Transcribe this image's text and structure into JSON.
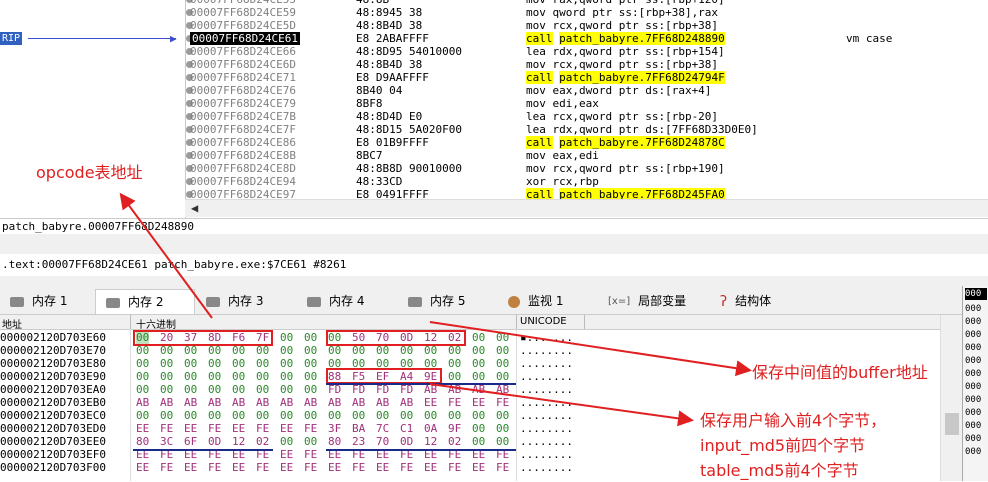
{
  "disasm": {
    "rip_label": "RIP",
    "rows": [
      {
        "addr": "00007FF68D24CE55",
        "bytes": "48:8B",
        "ins": "mov rax,qword ptr ss:[rbp+120]",
        "cmt": ""
      },
      {
        "addr": "00007FF68D24CE59",
        "bytes": "48:8945 38",
        "ins": "mov qword ptr ss:[rbp+38],rax",
        "cmt": ""
      },
      {
        "addr": "00007FF68D24CE5D",
        "bytes": "48:8B4D 38",
        "ins": "mov rcx,qword ptr ss:[rbp+38]",
        "cmt": ""
      },
      {
        "addr": "00007FF68D24CE61",
        "bytes": "E8 2ABAFFFF",
        "ins_kw": "call",
        "ins_arg": "patch_babyre.7FF68D248890",
        "cmt": "vm case",
        "current": true
      },
      {
        "addr": "00007FF68D24CE66",
        "bytes": "48:8D95 54010000",
        "ins": "lea rdx,qword ptr ss:[rbp+154]",
        "cmt": ""
      },
      {
        "addr": "00007FF68D24CE6D",
        "bytes": "48:8B4D 38",
        "ins": "mov rcx,qword ptr ss:[rbp+38]",
        "cmt": ""
      },
      {
        "addr": "00007FF68D24CE71",
        "bytes": "E8 D9AAFFFF",
        "ins_kw": "call",
        "ins_arg": "patch_babyre.7FF68D24794F",
        "cmt": ""
      },
      {
        "addr": "00007FF68D24CE76",
        "bytes": "8B40 04",
        "ins": "mov eax,dword ptr ds:[rax+4]",
        "cmt": ""
      },
      {
        "addr": "00007FF68D24CE79",
        "bytes": "8BF8",
        "ins": "mov edi,eax",
        "cmt": ""
      },
      {
        "addr": "00007FF68D24CE7B",
        "bytes": "48:8D4D E0",
        "ins": "lea rcx,qword ptr ss:[rbp-20]",
        "cmt": ""
      },
      {
        "addr": "00007FF68D24CE7F",
        "bytes": "48:8D15 5A020F00",
        "ins": "lea rdx,qword ptr ds:[7FF68D33D0E0]",
        "cmt": ""
      },
      {
        "addr": "00007FF68D24CE86",
        "bytes": "E8 01B9FFFF",
        "ins_kw": "call",
        "ins_arg": "patch_babyre.7FF68D24878C",
        "cmt": ""
      },
      {
        "addr": "00007FF68D24CE8B",
        "bytes": "8BC7",
        "ins": "mov eax,edi",
        "cmt": ""
      },
      {
        "addr": "00007FF68D24CE8D",
        "bytes": "48:8B8D 90010000",
        "ins": "mov rcx,qword ptr ss:[rbp+190]",
        "cmt": ""
      },
      {
        "addr": "00007FF68D24CE94",
        "bytes": "48:33CD",
        "ins": "xor rcx,rbp",
        "cmt": ""
      },
      {
        "addr": "00007FF68D24CE97",
        "bytes": "E8 0491FFFF",
        "ins_kw": "call",
        "ins_arg": "patch_babyre.7FF68D245FA0",
        "cmt": ""
      }
    ]
  },
  "info_line1": "patch_babyre.00007FF68D248890",
  "info_line2": ".text:00007FF68D24CE61 patch_babyre.exe:$7CE61 #8261",
  "tabs": [
    {
      "label": "内存 1",
      "icon": "memory-icon"
    },
    {
      "label": "内存 2",
      "icon": "memory-icon",
      "active": true
    },
    {
      "label": "内存 3",
      "icon": "memory-icon"
    },
    {
      "label": "内存 4",
      "icon": "memory-icon"
    },
    {
      "label": "内存 5",
      "icon": "memory-icon"
    },
    {
      "label": "监视 1",
      "icon": "watch-icon"
    },
    {
      "label": "局部变量",
      "icon": "locals-icon",
      "prefix": "[x=]"
    },
    {
      "label": "结构体",
      "icon": "struct-icon"
    }
  ],
  "hex": {
    "col_addr": "地址",
    "col_hex": "十六进制",
    "col_ascii": "UNICODE",
    "rows": [
      {
        "addr": "000002120D703E60",
        "bytes": [
          "00",
          "20",
          "37",
          "8D",
          "F6",
          "7F",
          "00",
          "00",
          "00",
          "50",
          "70",
          "0D",
          "12",
          "02",
          "00",
          "00"
        ],
        "ascii": "▪......."
      },
      {
        "addr": "000002120D703E70",
        "bytes": [
          "00",
          "00",
          "00",
          "00",
          "00",
          "00",
          "00",
          "00",
          "00",
          "00",
          "00",
          "00",
          "00",
          "00",
          "00",
          "00"
        ],
        "ascii": "........"
      },
      {
        "addr": "000002120D703E80",
        "bytes": [
          "00",
          "00",
          "00",
          "00",
          "00",
          "00",
          "00",
          "00",
          "00",
          "00",
          "00",
          "00",
          "00",
          "00",
          "00",
          "00"
        ],
        "ascii": "........"
      },
      {
        "addr": "000002120D703E90",
        "bytes": [
          "00",
          "00",
          "00",
          "00",
          "00",
          "00",
          "00",
          "00",
          "88",
          "F5",
          "EF",
          "A4",
          "9E",
          "00",
          "00",
          "00"
        ],
        "ascii": "........"
      },
      {
        "addr": "000002120D703EA0",
        "bytes": [
          "00",
          "00",
          "00",
          "00",
          "00",
          "00",
          "00",
          "00",
          "FD",
          "FD",
          "FD",
          "FD",
          "AB",
          "AB",
          "AB",
          "AB"
        ],
        "ascii": "........"
      },
      {
        "addr": "000002120D703EB0",
        "bytes": [
          "AB",
          "AB",
          "AB",
          "AB",
          "AB",
          "AB",
          "AB",
          "AB",
          "AB",
          "AB",
          "AB",
          "AB",
          "EE",
          "FE",
          "EE",
          "FE"
        ],
        "ascii": "........"
      },
      {
        "addr": "000002120D703EC0",
        "bytes": [
          "00",
          "00",
          "00",
          "00",
          "00",
          "00",
          "00",
          "00",
          "00",
          "00",
          "00",
          "00",
          "00",
          "00",
          "00",
          "00"
        ],
        "ascii": "........"
      },
      {
        "addr": "000002120D703ED0",
        "bytes": [
          "EE",
          "FE",
          "EE",
          "FE",
          "EE",
          "FE",
          "EE",
          "FE",
          "3F",
          "BA",
          "7C",
          "C1",
          "0A",
          "9F",
          "00",
          "00"
        ],
        "ascii": "........"
      },
      {
        "addr": "000002120D703EE0",
        "bytes": [
          "80",
          "3C",
          "6F",
          "0D",
          "12",
          "02",
          "00",
          "00",
          "80",
          "23",
          "70",
          "0D",
          "12",
          "02",
          "00",
          "00"
        ],
        "ascii": "........"
      },
      {
        "addr": "000002120D703EF0",
        "bytes": [
          "EE",
          "FE",
          "EE",
          "FE",
          "EE",
          "FE",
          "EE",
          "FE",
          "EE",
          "FE",
          "EE",
          "FE",
          "EE",
          "FE",
          "EE",
          "FE"
        ],
        "ascii": "........"
      },
      {
        "addr": "000002120D703F00",
        "bytes": [
          "EE",
          "FE",
          "EE",
          "FE",
          "EE",
          "FE",
          "EE",
          "FE",
          "EE",
          "FE",
          "EE",
          "FE",
          "EE",
          "FE",
          "EE",
          "FE"
        ],
        "ascii": "........"
      }
    ]
  },
  "right_pane": {
    "header": "000",
    "values": [
      "000",
      "000",
      "000",
      "000",
      "000",
      "000",
      "000",
      "000",
      "000",
      "000",
      "000",
      "000"
    ]
  },
  "annotations": {
    "opcode": "opcode表地址",
    "buffer": "保存中间值的buffer地址",
    "input1": "保存用户输入前4个字节，",
    "input2": "input_md5前四个字节",
    "input3": "table_md5前4个字节"
  },
  "colors": {
    "accent_red": "#e02020",
    "call_highlight": "#ffff00",
    "rip_blue": "#3a4fcf"
  }
}
